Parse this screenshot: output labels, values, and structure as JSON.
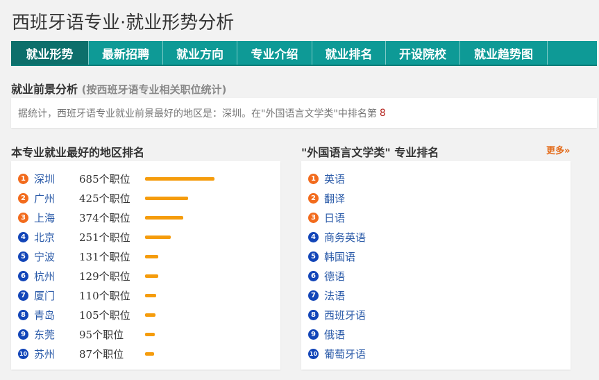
{
  "page_title": "西班牙语专业·就业形势分析",
  "tabs": [
    {
      "label": "就业形势",
      "active": true
    },
    {
      "label": "最新招聘",
      "active": false
    },
    {
      "label": "就业方向",
      "active": false
    },
    {
      "label": "专业介绍",
      "active": false
    },
    {
      "label": "就业排名",
      "active": false
    },
    {
      "label": "开设院校",
      "active": false
    },
    {
      "label": "就业趋势图",
      "active": false
    }
  ],
  "prospect": {
    "title": "就业前景分析",
    "subtitle": "(按西班牙语专业相关职位统计)",
    "summary": "据统计，西班牙语专业就业前景最好的地区是：深圳。在\"外国语言文学类\"中排名第",
    "rank": "8"
  },
  "regions": {
    "title": "本专业就业最好的地区排名",
    "items": [
      {
        "rank": "1",
        "city": "深圳",
        "count": "685个职位",
        "value": 685
      },
      {
        "rank": "2",
        "city": "广州",
        "count": "425个职位",
        "value": 425
      },
      {
        "rank": "3",
        "city": "上海",
        "count": "374个职位",
        "value": 374
      },
      {
        "rank": "4",
        "city": "北京",
        "count": "251个职位",
        "value": 251
      },
      {
        "rank": "5",
        "city": "宁波",
        "count": "131个职位",
        "value": 131
      },
      {
        "rank": "6",
        "city": "杭州",
        "count": "129个职位",
        "value": 129
      },
      {
        "rank": "7",
        "city": "厦门",
        "count": "110个职位",
        "value": 110
      },
      {
        "rank": "8",
        "city": "青岛",
        "count": "105个职位",
        "value": 105
      },
      {
        "rank": "9",
        "city": "东莞",
        "count": "95个职位",
        "value": 95
      },
      {
        "rank": "10",
        "city": "苏州",
        "count": "87个职位",
        "value": 87
      }
    ]
  },
  "majors": {
    "title": "\"外国语言文学类\" 专业排名",
    "more": "更多»",
    "items": [
      {
        "rank": "1",
        "name": "英语"
      },
      {
        "rank": "2",
        "name": "翻译"
      },
      {
        "rank": "3",
        "name": "日语"
      },
      {
        "rank": "4",
        "name": "商务英语"
      },
      {
        "rank": "5",
        "name": "韩国语"
      },
      {
        "rank": "6",
        "name": "德语"
      },
      {
        "rank": "7",
        "name": "法语"
      },
      {
        "rank": "8",
        "name": "西班牙语"
      },
      {
        "rank": "9",
        "name": "俄语"
      },
      {
        "rank": "10",
        "name": "葡萄牙语"
      }
    ]
  },
  "colors": {
    "tab_bg": "#0e9a96",
    "tab_active": "#0d6f6b",
    "bar": "#f59c0c",
    "badge_top": "#f26b1d",
    "badge_rest": "#1245b8",
    "link": "#2a5aa8"
  }
}
